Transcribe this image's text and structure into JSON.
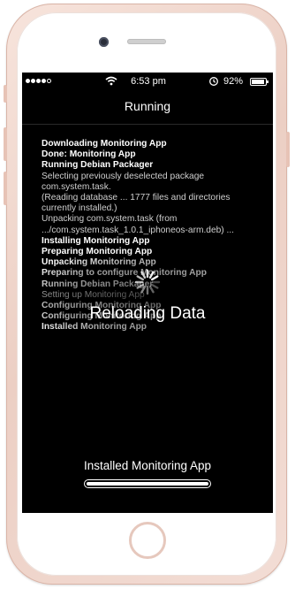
{
  "status_bar": {
    "signal_dots": [
      true,
      true,
      true,
      true,
      false
    ],
    "time": "6:53 pm",
    "battery_percent": "92%",
    "battery_level": 0.92
  },
  "nav": {
    "title": "Running"
  },
  "log_lines": [
    {
      "text": "Downloading Monitoring App",
      "bold": true
    },
    {
      "text": "Done: Monitoring App",
      "bold": true
    },
    {
      "text": "Running Debian Packager",
      "bold": true
    },
    {
      "text": "Selecting previously deselected package",
      "bold": false
    },
    {
      "text": "com.system.task.",
      "bold": false
    },
    {
      "text": "(Reading database ... 1777 files and directories",
      "bold": false
    },
    {
      "text": "currently installed.)",
      "bold": false
    },
    {
      "text": "Unpacking com.system.task (from",
      "bold": false
    },
    {
      "text": ".../com.system.task_1.0.1_iphoneos-arm.deb) ...",
      "bold": false
    },
    {
      "text": "Installing Monitoring App",
      "bold": true
    },
    {
      "text": "Preparing Monitoring App",
      "bold": true
    },
    {
      "text": "Unpacking Monitoring App",
      "bold": true
    },
    {
      "text": "Preparing to configure Monitoring App",
      "bold": true
    },
    {
      "text": "Running Debian Packager",
      "bold": true
    },
    {
      "text": "Setting up Monitoring App",
      "bold": false
    },
    {
      "text": "Configuring Monitoring App",
      "bold": true
    },
    {
      "text": "Configuring Monitoring App",
      "bold": true
    },
    {
      "text": "Installed Monitoring App",
      "bold": true
    }
  ],
  "overlay": {
    "label": "Reloading Data"
  },
  "footer": {
    "status": "Installed Monitoring App",
    "progress": 1.0
  },
  "colors": {
    "screen_bg": "#000000",
    "phone_shell": "#f1d8ce",
    "text": "#ffffff"
  },
  "icons": [
    "wifi-icon",
    "alarm-icon",
    "battery-icon",
    "spinner-icon"
  ]
}
